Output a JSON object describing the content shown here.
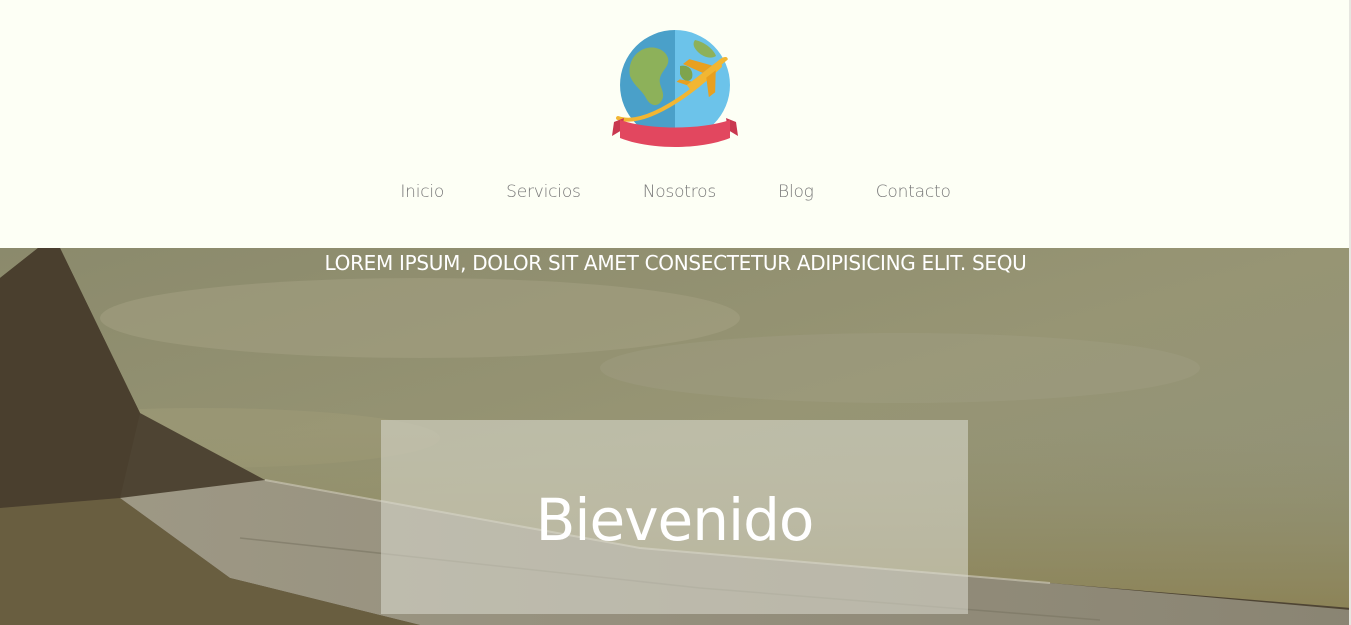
{
  "logo": {
    "icon": "globe-airplane-icon",
    "colors": {
      "globe_left": "#4aa0c9",
      "globe_right": "#6cc3ea",
      "land": "#8db15a",
      "plane": "#f2b632",
      "ribbon": "#e2475f"
    }
  },
  "nav": {
    "items": [
      {
        "label": "Inicio"
      },
      {
        "label": "Servicios"
      },
      {
        "label": "Nosotros"
      },
      {
        "label": "Blog"
      },
      {
        "label": "Contacto"
      }
    ]
  },
  "hero": {
    "tagline": "LOREM IPSUM, DOLOR SIT AMET CONSECTETUR ADIPISICING ELIT. SEQU",
    "welcome": "Bievenido",
    "colors": {
      "sky": "#8f8f6e",
      "wing": "#4b4232"
    }
  }
}
